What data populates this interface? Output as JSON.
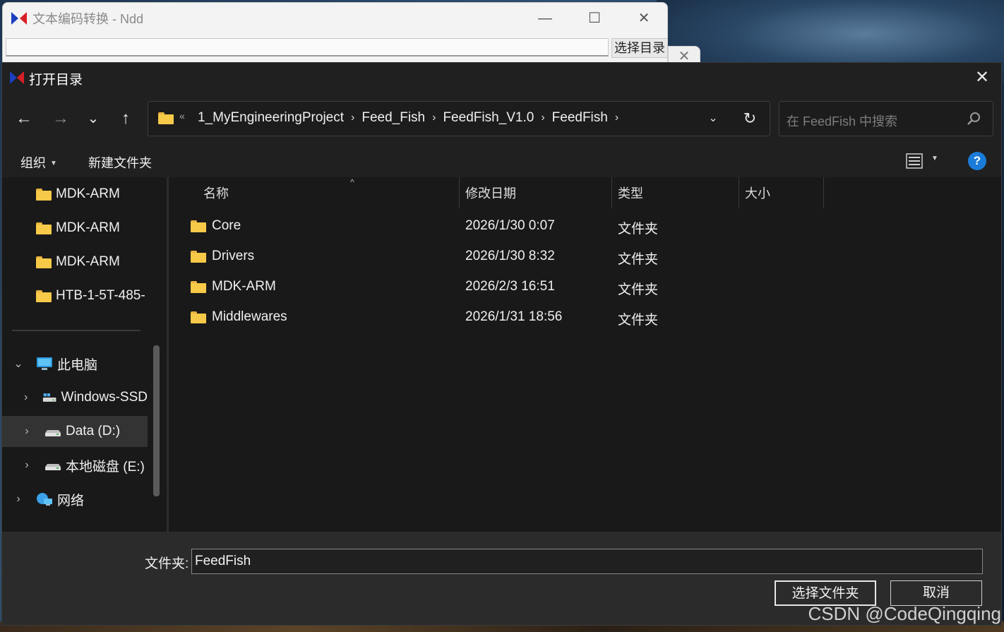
{
  "background_window": {
    "title": "文本编码转换 - Ndd",
    "select_button": "选择目录",
    "minimize": "—",
    "maximize": "☐",
    "close": "✕",
    "behind_close": "✕"
  },
  "dialog": {
    "title": "打开目录",
    "close": "✕"
  },
  "nav": {
    "back": "←",
    "forward": "→",
    "recent": "⌄",
    "up": "↑",
    "breadcrumb_overflow": "«",
    "breadcrumbs": [
      "1_MyEngineeringProject",
      "Feed_Fish",
      "FeedFish_V1.0",
      "FeedFish"
    ],
    "separator": "›",
    "dropdown": "⌄",
    "refresh": "↻",
    "search_placeholder": "在 FeedFish 中搜索"
  },
  "toolbar": {
    "organize": "组织",
    "new_folder": "新建文件夹",
    "help": "?"
  },
  "nav_pane": {
    "quick_items": [
      "MDK-ARM",
      "MDK-ARM",
      "MDK-ARM",
      "HTB-1-5T-485-"
    ],
    "this_pc": "此电脑",
    "drives": [
      "Windows-SSD",
      "Data (D:)",
      "本地磁盘 (E:)"
    ],
    "network": "网络",
    "expand": "⌄",
    "collapse": "›"
  },
  "file_list": {
    "columns": [
      "名称",
      "修改日期",
      "类型",
      "大小"
    ],
    "sort_indicator": "^",
    "rows": [
      {
        "name": "Core",
        "date": "2026/1/30 0:07",
        "type": "文件夹"
      },
      {
        "name": "Drivers",
        "date": "2026/1/30 8:32",
        "type": "文件夹"
      },
      {
        "name": "MDK-ARM",
        "date": "2026/2/3 16:51",
        "type": "文件夹"
      },
      {
        "name": "Middlewares",
        "date": "2026/1/31 18:56",
        "type": "文件夹"
      }
    ]
  },
  "footer": {
    "folder_label": "文件夹:",
    "folder_value": "FeedFish",
    "select_button": "选择文件夹",
    "cancel_button": "取消"
  },
  "watermark": "CSDN @CodeQingqing",
  "colors": {
    "dialog_bg": "#191919",
    "folder": "#f7c948",
    "help": "#1a7bd8"
  }
}
